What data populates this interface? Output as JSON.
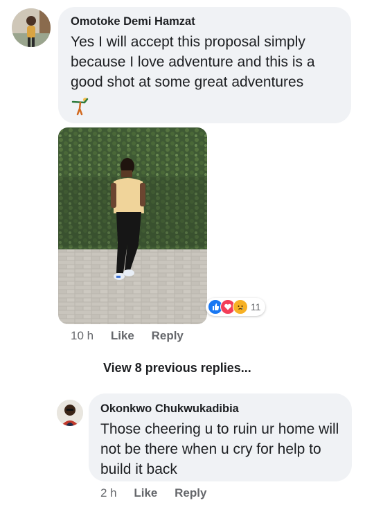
{
  "comment1": {
    "author": "Omotoke Demi Hamzat",
    "text": "Yes I will accept this proposal simply because I love adventure and this is a good shot at some great adventures",
    "time": "10 h",
    "like_label": "Like",
    "reply_label": "Reply",
    "reaction_count": "11"
  },
  "view_previous": "View 8 previous replies...",
  "comment2": {
    "author": "Okonkwo Chukwukadibia",
    "text": "Those cheering u to ruin ur home will not be there when u cry for help to build it back",
    "time": "2 h",
    "like_label": "Like",
    "reply_label": "Reply"
  },
  "colors": {
    "bubble": "#f0f2f5",
    "secondary_text": "#65676b",
    "like_blue": "#1877f2",
    "love_red": "#f33e58",
    "sad_yellow": "#f7b125"
  }
}
